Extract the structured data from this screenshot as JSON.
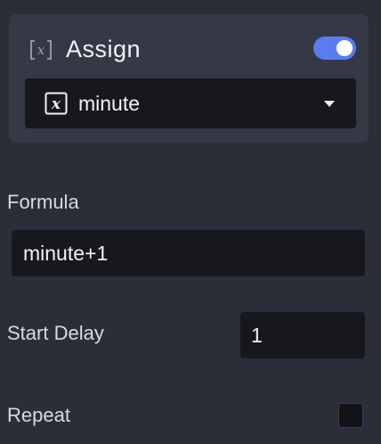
{
  "assign": {
    "title": "Assign",
    "icon": "variable-icon",
    "enabled": true,
    "toggle_color": "#5b7cf0",
    "variable": {
      "icon": "variable-x-icon",
      "selected_value": "minute"
    }
  },
  "formula": {
    "label": "Formula",
    "value": "minute+1"
  },
  "start_delay": {
    "label": "Start Delay",
    "value": "1"
  },
  "repeat": {
    "label": "Repeat",
    "checked": false
  }
}
